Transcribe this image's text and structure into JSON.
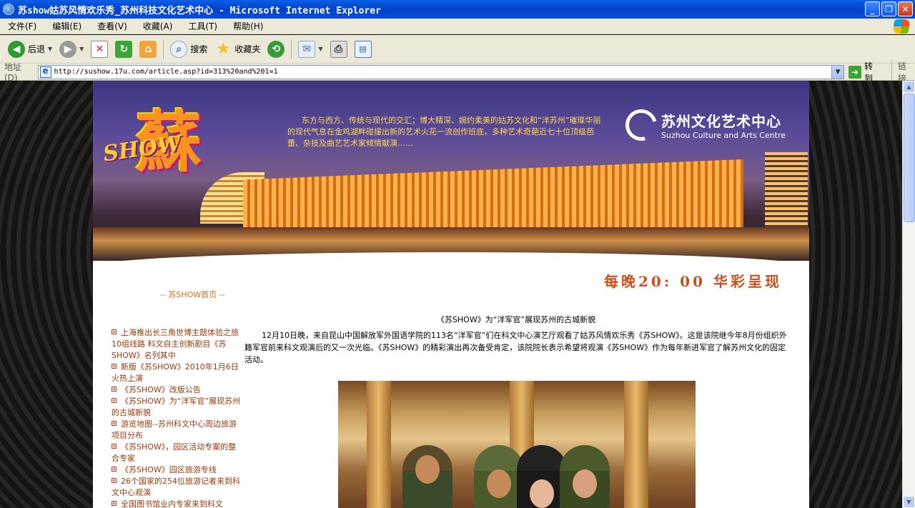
{
  "window": {
    "title": "苏show姑苏风情欢乐秀_苏州科技文化艺术中心 - Microsoft Internet Explorer"
  },
  "menu": [
    "文件(F)",
    "编辑(E)",
    "查看(V)",
    "收藏(A)",
    "工具(T)",
    "帮助(H)"
  ],
  "toolbar": {
    "back_label": "后退",
    "search_label": "搜索",
    "favorites_label": "收藏夹"
  },
  "address": {
    "label": "地址(D)",
    "url": "http://sushow.17u.com/article.asp?id=313%20and%201=1",
    "go_label": "转到",
    "links_label": "链接"
  },
  "banner": {
    "logo_char": "蘇",
    "logo_show": "SHOW",
    "intro": "东方与西方、传统与现代的交汇；博大精深、婉约柔美的姑苏文化和“洋苏州”璀璨华丽的现代气息在金鸡湖畔碰撞出新的艺术火花一流创作班底，多种艺术奇葩近七十位顶级芭蕾、杂技及曲艺艺术家倾情献演……",
    "center_name_cn": "苏州文化艺术中心",
    "center_name_en": "Suzhou Culture and Arts Centre"
  },
  "slogan": "每晚20: 00 华彩呈现",
  "home_link": "-- 苏SHOW首页 --",
  "sidebar": {
    "items": [
      "上海推出长三角世博主题体验之旅10组线路 科文自主创新剧目《苏SHOW》名列其中",
      "新版《苏SHOW》2010年1月6日火热上演",
      "《苏SHOW》改版公告",
      "《苏SHOW》为“洋军官”展现苏州的古城新貌",
      "游览地图--苏州科文中心周边旅游项目分布",
      "《苏SHOW》，园区活动专案的整合专家",
      "《苏SHOW》园区旅游专线",
      "26个国家的254位旅游记者来到科文中心观演",
      "全国图书馆业内专家来到科文"
    ]
  },
  "article": {
    "title": "《苏SHOW》为“洋军官”展现苏州的古城新貌",
    "body": "12月10日晚，来自昆山中国解放军外国语学院的113名“洋军官”们在科文中心演艺厅观看了姑苏风情欢乐秀《苏SHOW》。这是该院继今年8月份组织外籍军官前来科文观演后的又一次光临。《苏SHOW》的精彩演出再次备受肯定，该院院长表示希望将观演《苏SHOW》作为每年新进军官了解苏州文化的固定活动。"
  }
}
